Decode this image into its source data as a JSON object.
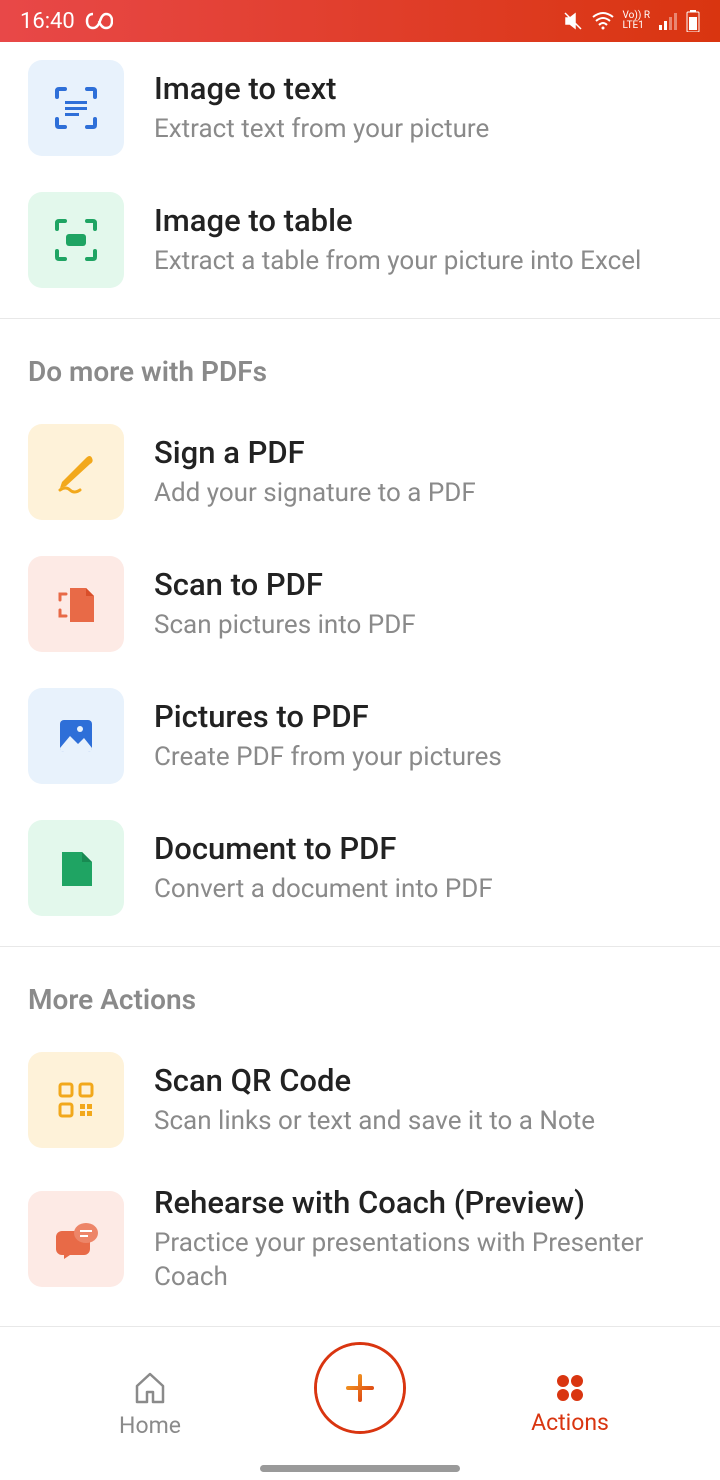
{
  "status": {
    "time": "16:40",
    "network": "LTE1",
    "roaming": "R",
    "volte": "Vo))"
  },
  "sections": {
    "image": {
      "items": [
        {
          "title": "Image to text",
          "desc": "Extract text from your picture"
        },
        {
          "title": "Image to table",
          "desc": "Extract a table from your picture into Excel"
        }
      ]
    },
    "pdf": {
      "header": "Do more with PDFs",
      "items": [
        {
          "title": "Sign a PDF",
          "desc": "Add your signature to a PDF"
        },
        {
          "title": "Scan to PDF",
          "desc": "Scan pictures into PDF"
        },
        {
          "title": "Pictures to PDF",
          "desc": "Create PDF from your pictures"
        },
        {
          "title": "Document to PDF",
          "desc": "Convert a document into PDF"
        }
      ]
    },
    "more": {
      "header": "More Actions",
      "items": [
        {
          "title": "Scan QR Code",
          "desc": "Scan links or text and save it to a Note"
        },
        {
          "title": "Rehearse with Coach (Preview)",
          "desc": "Practice your presentations with Presenter Coach"
        }
      ]
    }
  },
  "nav": {
    "home": "Home",
    "actions": "Actions"
  }
}
